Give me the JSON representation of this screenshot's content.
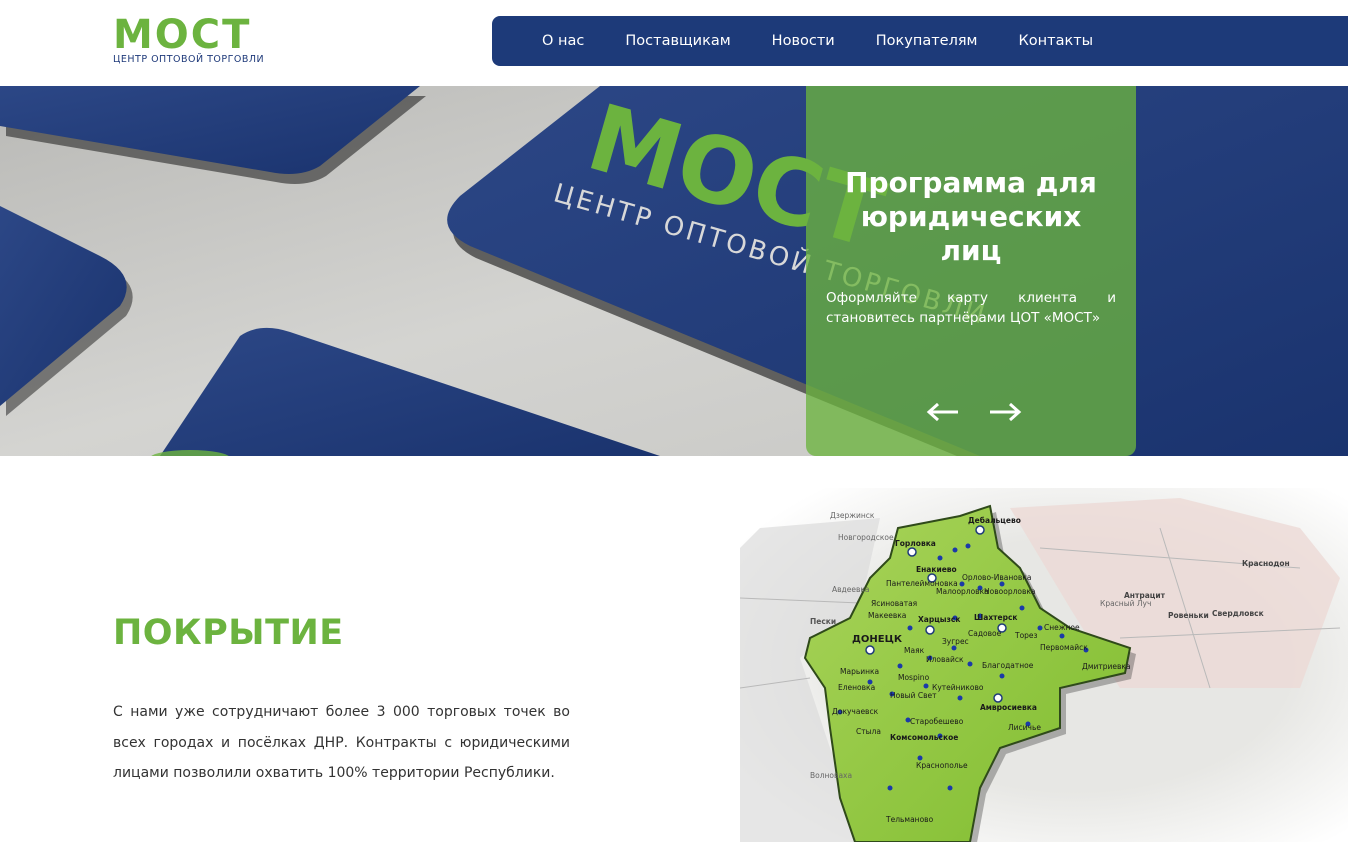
{
  "brand": {
    "logo_word": "МОСТ",
    "logo_subtitle": "ЦЕНТР ОПТОВОЙ ТОРГОВЛИ",
    "accent_green": "#6cb33f",
    "navy": "#1d3a79"
  },
  "nav": {
    "items": [
      {
        "label": "О нас"
      },
      {
        "label": "Поставщикам"
      },
      {
        "label": "Новости"
      },
      {
        "label": "Покупателям"
      },
      {
        "label": "Контакты"
      }
    ]
  },
  "hero": {
    "background_logo_word": "МОСТ",
    "background_logo_subtitle": "ЦЕНТР ОПТОВОЙ ТОРГОВЛИ",
    "slide": {
      "title": "Программа для юридических лиц",
      "text": "Оформляйте карту клиента и становитесь партнёрами ЦОТ «МОСТ»"
    },
    "prev_icon": "arrow-left-icon",
    "next_icon": "arrow-right-icon"
  },
  "coverage": {
    "title": "ПОКРЫТИЕ",
    "text": "С нами уже сотрудничают более 3 000 торговых точек во всех городах и посёлках ДНР. Контракты с юридическими лицами позволили охватить 100% территории Республики."
  },
  "map": {
    "labels": {
      "dzerzhinsk": "Дзержинск",
      "novgorodskoe": "Новгородское",
      "gorlovka": "Горловка",
      "debaltsevo": "Дебальцево",
      "enakievo": "Енакиево",
      "panteleimonovka": "Пантелеймоновка",
      "orlovo_ivanovka": "Орлово-Ивановка",
      "maloorlovka": "Малоорловка",
      "novoorlovka": "Новоорловка",
      "yasinovataya": "Ясиноватая",
      "makeevka": "Макеевка",
      "khartsyzsk": "Харцызск",
      "shakhtersk": "Шахтерск",
      "snezhnoe": "Снежное",
      "donetsk": "ДОНЕЦК",
      "zugres": "Зугрес",
      "sadovoe": "Садовое",
      "torez": "Торез",
      "pervomaisk": "Первомайск",
      "dmitrievka": "Дмитриевка",
      "mayak": "Маяк",
      "ilovaisk": "Иловайск",
      "blagodatnoe": "Благодатное",
      "maryinka": "Марьинка",
      "elenovka": "Еленовка",
      "mospino": "Мospino",
      "kuteinikovo": "Кутейниково",
      "novy_svet": "Новый Свет",
      "amvrosievka": "Амвросиевка",
      "dokuchaevsk": "Докучаевск",
      "starobeshevo": "Старобешево",
      "lisichye": "Лисичье",
      "stylа": "Стыла",
      "komsomolskoe": "Комсомольское",
      "krasnopolye": "Краснополье",
      "telmanovo": "Тельманово",
      "peski": "Пески",
      "avdeevka": "Авдеевка",
      "antratsit": "Антрацит",
      "rovenki": "Ровеньки",
      "sverdlovsk": "Свердловск",
      "krasnodon": "Краснодон",
      "volnovakha": "Волноваха",
      "krasny_luch": "Красный Луч"
    }
  }
}
